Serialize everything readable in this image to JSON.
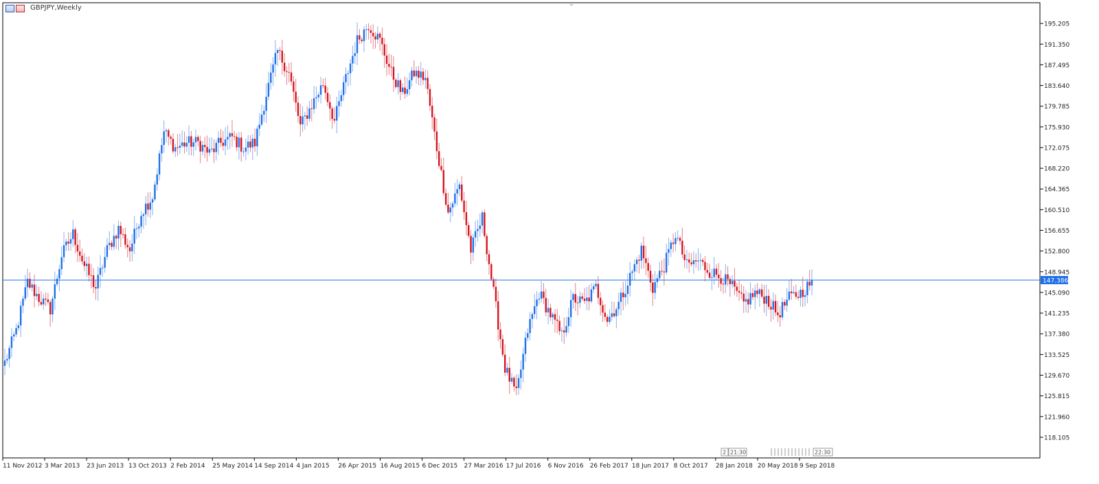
{
  "window": {
    "title": "GBPJPY,Weekly",
    "icons": [
      "chart-window-icon",
      "chart-window-icon-red"
    ]
  },
  "chart_data": {
    "type": "candlestick",
    "symbol": "GBPJPY",
    "timeframe": "Weekly",
    "ylim": [
      114.255,
      199.06
    ],
    "y_ticks": [
      "195.205",
      "191.350",
      "187.495",
      "183.640",
      "179.785",
      "175.930",
      "172.075",
      "168.220",
      "164.365",
      "160.510",
      "156.655",
      "152.800",
      "148.945",
      "145.090",
      "141.235",
      "137.380",
      "133.525",
      "129.670",
      "125.815",
      "121.960",
      "118.105"
    ],
    "x_ticks": [
      "11 Nov 2012",
      "3 Mar 2013",
      "23 Jun 2013",
      "13 Oct 2013",
      "2 Feb 2014",
      "25 May 2014",
      "14 Sep 2014",
      "4 Jan 2015",
      "26 Apr 2015",
      "16 Aug 2015",
      "6 Dec 2015",
      "27 Mar 2016",
      "17 Jul 2016",
      "6 Nov 2016",
      "26 Feb 2017",
      "18 Jun 2017",
      "8 Oct 2017",
      "28 Jan 2018",
      "20 May 2018",
      "9 Sep 2018"
    ],
    "current_price": 147.386,
    "current_price_label": "147.386",
    "colors": {
      "up": "#1e6fe8",
      "down": "#d4141e",
      "price_line": "#1e6fe8",
      "axis": "#000000"
    },
    "anchors": [
      132,
      138,
      147,
      144,
      142,
      152,
      156,
      150,
      146,
      153,
      157,
      153,
      160,
      163,
      175,
      172,
      173,
      173,
      171,
      173,
      174,
      172,
      173,
      182,
      190,
      186,
      176,
      180,
      184,
      177,
      185,
      192,
      195,
      192,
      186,
      182,
      186,
      185,
      172,
      160,
      165,
      153,
      159,
      145,
      131,
      126,
      138,
      145,
      141,
      137,
      144,
      143,
      146,
      140,
      143,
      148,
      153,
      146,
      150,
      156,
      150,
      151,
      149,
      148,
      146,
      143,
      145,
      144,
      141,
      144,
      145,
      147
    ],
    "series": [],
    "time_markers": [
      "2",
      "21:30",
      "22:30"
    ],
    "grid": false
  }
}
